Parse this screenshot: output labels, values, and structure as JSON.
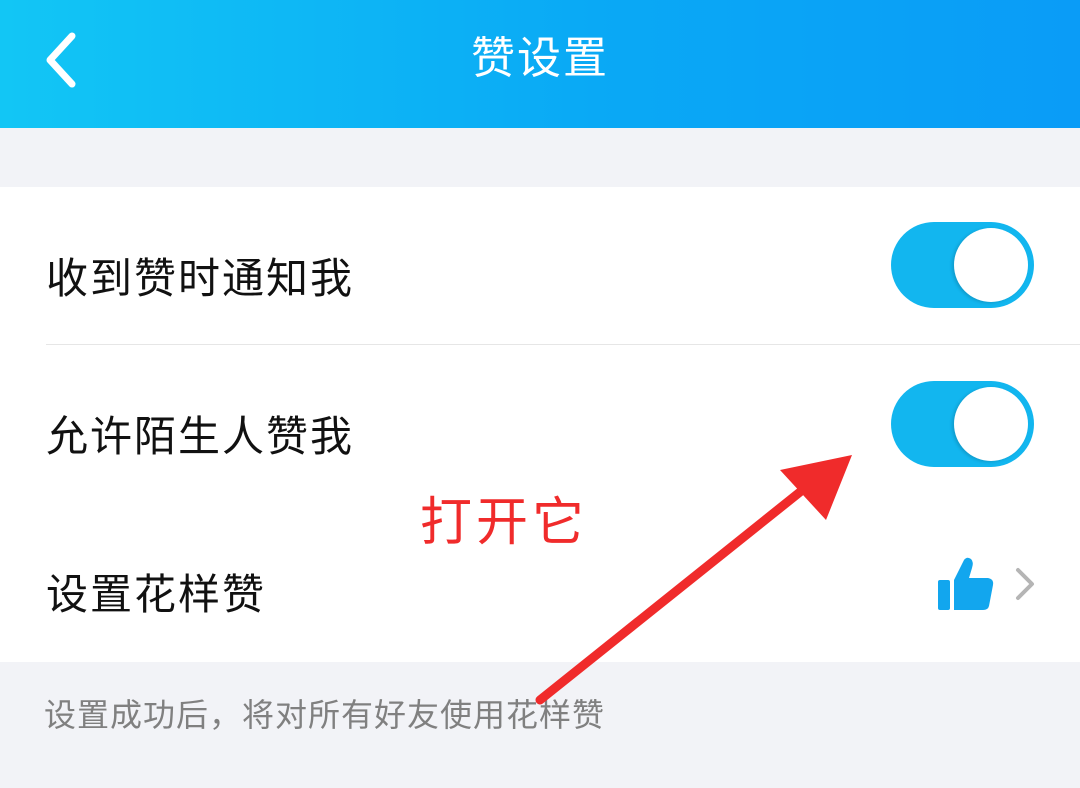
{
  "header": {
    "title": "赞设置",
    "back_icon": "chevron-left-icon"
  },
  "settings": {
    "items": [
      {
        "label": "收到赞时通知我",
        "control": "toggle",
        "on": true
      },
      {
        "label": "允许陌生人赞我",
        "control": "toggle",
        "on": true
      },
      {
        "label": "设置花样赞",
        "control": "link",
        "icon": "thumbs-up-icon",
        "trailing_icon": "chevron-right-icon"
      }
    ]
  },
  "footer_note": "设置成功后，将对所有好友使用花样赞",
  "annotation": {
    "text": "打开它",
    "color": "#f02b2b"
  },
  "colors": {
    "header_start": "#12c6f5",
    "header_end": "#0a9cf7",
    "toggle_on": "#12b6ef",
    "page_bg": "#f2f3f7"
  }
}
